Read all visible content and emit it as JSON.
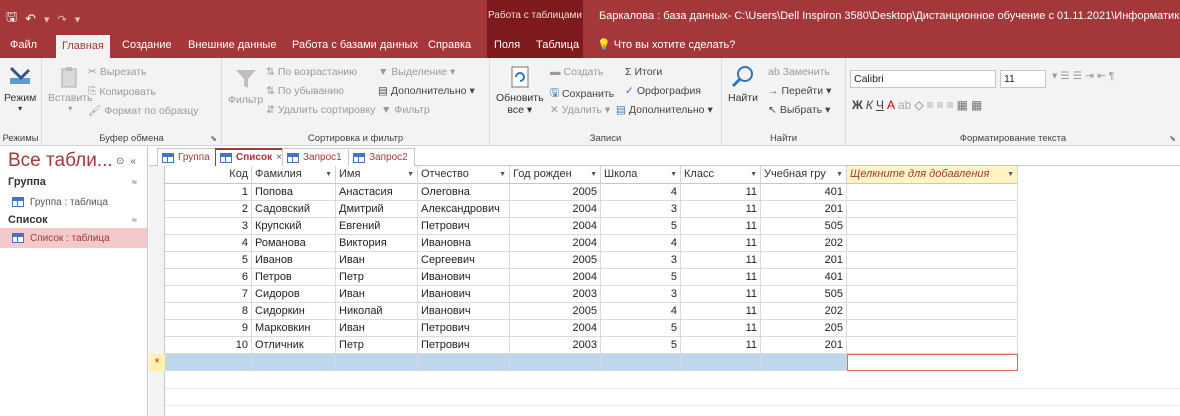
{
  "titlebar": {
    "context_tab": "Работа с таблицами",
    "title": "Баркалова : база данных- C:\\Users\\Dell Inspiron 3580\\Desktop\\Дистанционное обучение с 01.11.2021\\Информатика 1..."
  },
  "menu": {
    "file": "Файл",
    "home": "Главная",
    "create": "Создание",
    "external": "Внешние данные",
    "db_tools": "Работа с базами данных",
    "help": "Справка",
    "fields": "Поля",
    "table": "Таблица",
    "tell_me": "Что вы хотите сделать?"
  },
  "ribbon": {
    "views": {
      "label": "Режимы",
      "mode": "Режим"
    },
    "clipboard": {
      "label": "Буфер обмена",
      "paste": "Вставить",
      "cut": "Вырезать",
      "copy": "Копировать",
      "format_painter": "Формат по образцу"
    },
    "sort_filter": {
      "label": "Сортировка и фильтр",
      "filter": "Фильтр",
      "ascending": "По возрастанию",
      "descending": "По убыванию",
      "remove_sort": "Удалить сортировку",
      "filter2": "Фильтр",
      "selection": "Выделение",
      "advanced": "Дополнительно"
    },
    "records": {
      "label": "Записи",
      "refresh": "Обновить",
      "refresh2": "все",
      "new": "Создать",
      "save": "Сохранить",
      "delete": "Удалить",
      "totals": "Итоги",
      "spelling": "Орфография",
      "more": "Дополнительно"
    },
    "find": {
      "label": "Найти",
      "find": "Найти",
      "replace": "Заменить",
      "goto": "Перейти",
      "select": "Выбрать"
    },
    "text_format": {
      "label": "Форматирование текста",
      "font": "Calibri",
      "size": "11"
    }
  },
  "nav": {
    "title": "Все табли...",
    "groups": [
      {
        "name": "Группа",
        "item": "Группа : таблица"
      },
      {
        "name": "Список",
        "item": "Список : таблица"
      }
    ]
  },
  "tabs": [
    "Группа",
    "Список",
    "Запрос1",
    "Запрос2"
  ],
  "table": {
    "headers": [
      "Код",
      "Фамилия",
      "Имя",
      "Отчество",
      "Год рожден",
      "Школа",
      "Класс",
      "Учебная гру",
      "Щелкните для добавления"
    ],
    "rows": [
      [
        "1",
        "Попова",
        "Анастасия",
        "Олеговна",
        "2005",
        "4",
        "11",
        "401"
      ],
      [
        "2",
        "Садовский",
        "Дмитрий",
        "Александрович",
        "2004",
        "3",
        "11",
        "201"
      ],
      [
        "3",
        "Крупский",
        "Евгений",
        "Петрович",
        "2004",
        "5",
        "11",
        "505"
      ],
      [
        "4",
        "Романова",
        "Виктория",
        "Ивановна",
        "2004",
        "4",
        "11",
        "202"
      ],
      [
        "5",
        "Иванов",
        "Иван",
        "Сергеевич",
        "2005",
        "3",
        "11",
        "201"
      ],
      [
        "6",
        "Петров",
        "Петр",
        "Иванович",
        "2004",
        "5",
        "11",
        "401"
      ],
      [
        "7",
        "Сидоров",
        "Иван",
        "Иванович",
        "2003",
        "3",
        "11",
        "505"
      ],
      [
        "8",
        "Сидоркин",
        "Николай",
        "Иванович",
        "2005",
        "4",
        "11",
        "202"
      ],
      [
        "9",
        "Марковкин",
        "Иван",
        "Петрович",
        "2004",
        "5",
        "11",
        "205"
      ],
      [
        "10",
        "Отличник",
        "Петр",
        "Петрович",
        "2003",
        "5",
        "11",
        "201"
      ]
    ],
    "new_row_marker": "*"
  }
}
